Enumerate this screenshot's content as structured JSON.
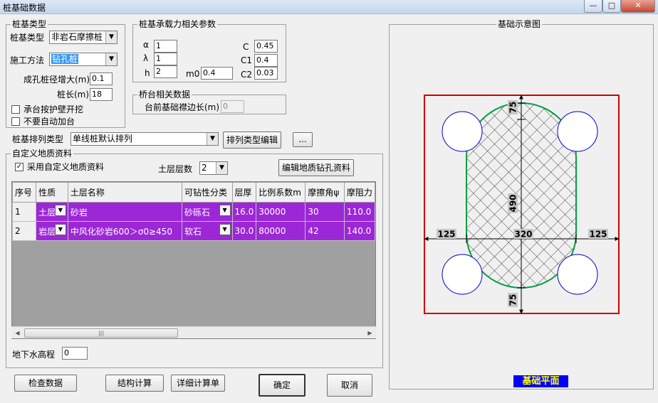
{
  "window": {
    "title": "桩基础数据",
    "min_glyph": "—",
    "max_glyph": "□",
    "close_glyph": "✕"
  },
  "pile_type": {
    "group_label": "桩基类型",
    "pile_type_label": "桩基类型",
    "pile_type_value": "非岩石摩擦桩",
    "method_label": "施工方法",
    "method_value": "钻孔桩",
    "diam_inc_label": "成孔桩径增大(m)",
    "diam_inc_value": "0.1",
    "length_label": "桩长(m)",
    "length_value": "18",
    "cb_excavation": "承台按护壁开挖",
    "cb_auto_cap": "不要自动加台"
  },
  "capacity": {
    "group_label": "桩基承载力相关参数",
    "alpha_label": "α",
    "alpha_value": "1",
    "lambda_label": "λ",
    "lambda_value": "1",
    "h_label": "h",
    "h_value": "2",
    "m0_label": "m0",
    "m0_value": "0.4",
    "c_label": "C",
    "c_value": "0.45",
    "c1_label": "C1",
    "c1_value": "0.4",
    "c2_label": "C2",
    "c2_value": "0.03"
  },
  "pier": {
    "group_label": "桥台相关数据",
    "edge_label": "台前基础襟边长(m)",
    "edge_value": "0"
  },
  "layout": {
    "label": "桩基排列类型",
    "value": "单线桩默认排列",
    "edit_button": "排列类型编辑",
    "more_button": "..."
  },
  "geology": {
    "group_label": "自定义地质资料",
    "use_custom_label": "采用自定义地质资料",
    "layers_label": "土层层数",
    "layers_value": "2",
    "edit_button": "编辑地质钻孔资料",
    "columns": [
      "序号",
      "性质",
      "土层名称",
      "可钻性分类",
      "层厚",
      "比例系数m",
      "摩擦角ψ",
      "摩阻力"
    ],
    "rows": [
      [
        "1",
        "土层",
        "砂岩",
        "砂砾石",
        "16.0",
        "30000",
        "30",
        "110.0"
      ],
      [
        "2",
        "岩层",
        "中风化砂岩600＞σ0≥450",
        "软石",
        "30.0",
        "80000",
        "42",
        "140.0"
      ]
    ],
    "groundwater_label": "地下水高程",
    "groundwater_value": "0"
  },
  "buttons": {
    "check": "检查数据",
    "structure": "结构计算",
    "detail": "详细计算单",
    "ok": "确定",
    "cancel": "取消"
  },
  "diagram": {
    "group_label": "基础示意图",
    "dim_top": "75",
    "dim_bottom": "75",
    "dim_left": "125",
    "dim_right": "125",
    "dim_width": "320",
    "dim_height": "490",
    "plan_label": "基础平面",
    "colors": {
      "frame": "#d00000",
      "outline": "#00a040",
      "pile": "#0000cc",
      "hatch": "#000000",
      "plan_bg": "#0000ff",
      "plan_text": "#ffff00"
    }
  }
}
